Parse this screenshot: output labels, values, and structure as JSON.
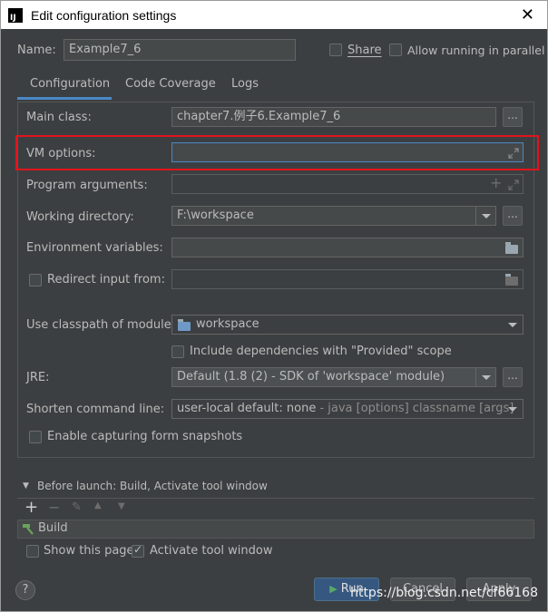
{
  "window": {
    "title": "Edit configuration settings"
  },
  "name_row": {
    "label": "Name:",
    "value": "Example7_6",
    "share_label": "Share",
    "allow_parallel_label": "Allow running in parallel"
  },
  "tabs": [
    {
      "label": "Configuration",
      "active": true
    },
    {
      "label": "Code Coverage",
      "active": false
    },
    {
      "label": "Logs",
      "active": false
    }
  ],
  "form": {
    "main_class": {
      "label": "Main class:",
      "value": "chapter7.例子6.Example7_6",
      "button": "..."
    },
    "vm_options": {
      "label": "VM options:",
      "value": ""
    },
    "program_arguments": {
      "label": "Program arguments:",
      "value": ""
    },
    "working_directory": {
      "label": "Working directory:",
      "value": "F:\\workspace",
      "button": "..."
    },
    "environment_variables": {
      "label": "Environment variables:",
      "value": ""
    },
    "redirect_input": {
      "label": "Redirect input from:",
      "value": ""
    },
    "classpath_module": {
      "label": "Use classpath of module:",
      "value": "workspace"
    },
    "include_dependencies": {
      "label": "Include dependencies with \"Provided\" scope"
    },
    "jre": {
      "label": "JRE:",
      "value": "Default (1.8 (2) - SDK of 'workspace' module)",
      "button": "..."
    },
    "shorten_command_line": {
      "label": "Shorten command line:",
      "value_main": "user-local default: none",
      "value_hint": " - java [options] classname [args]"
    },
    "enable_snapshots": {
      "label": "Enable capturing form snapshots"
    }
  },
  "before_launch": {
    "header": "Before launch: Build, Activate tool window",
    "items": [
      {
        "label": "Build"
      }
    ],
    "show_this_page": "Show this page",
    "activate_tool_window": "Activate tool window"
  },
  "footer": {
    "help": "?",
    "run": "Run",
    "cancel": "Cancel",
    "apply": "Apply",
    "watermark": "https://blog.csdn.net/cf66168"
  }
}
